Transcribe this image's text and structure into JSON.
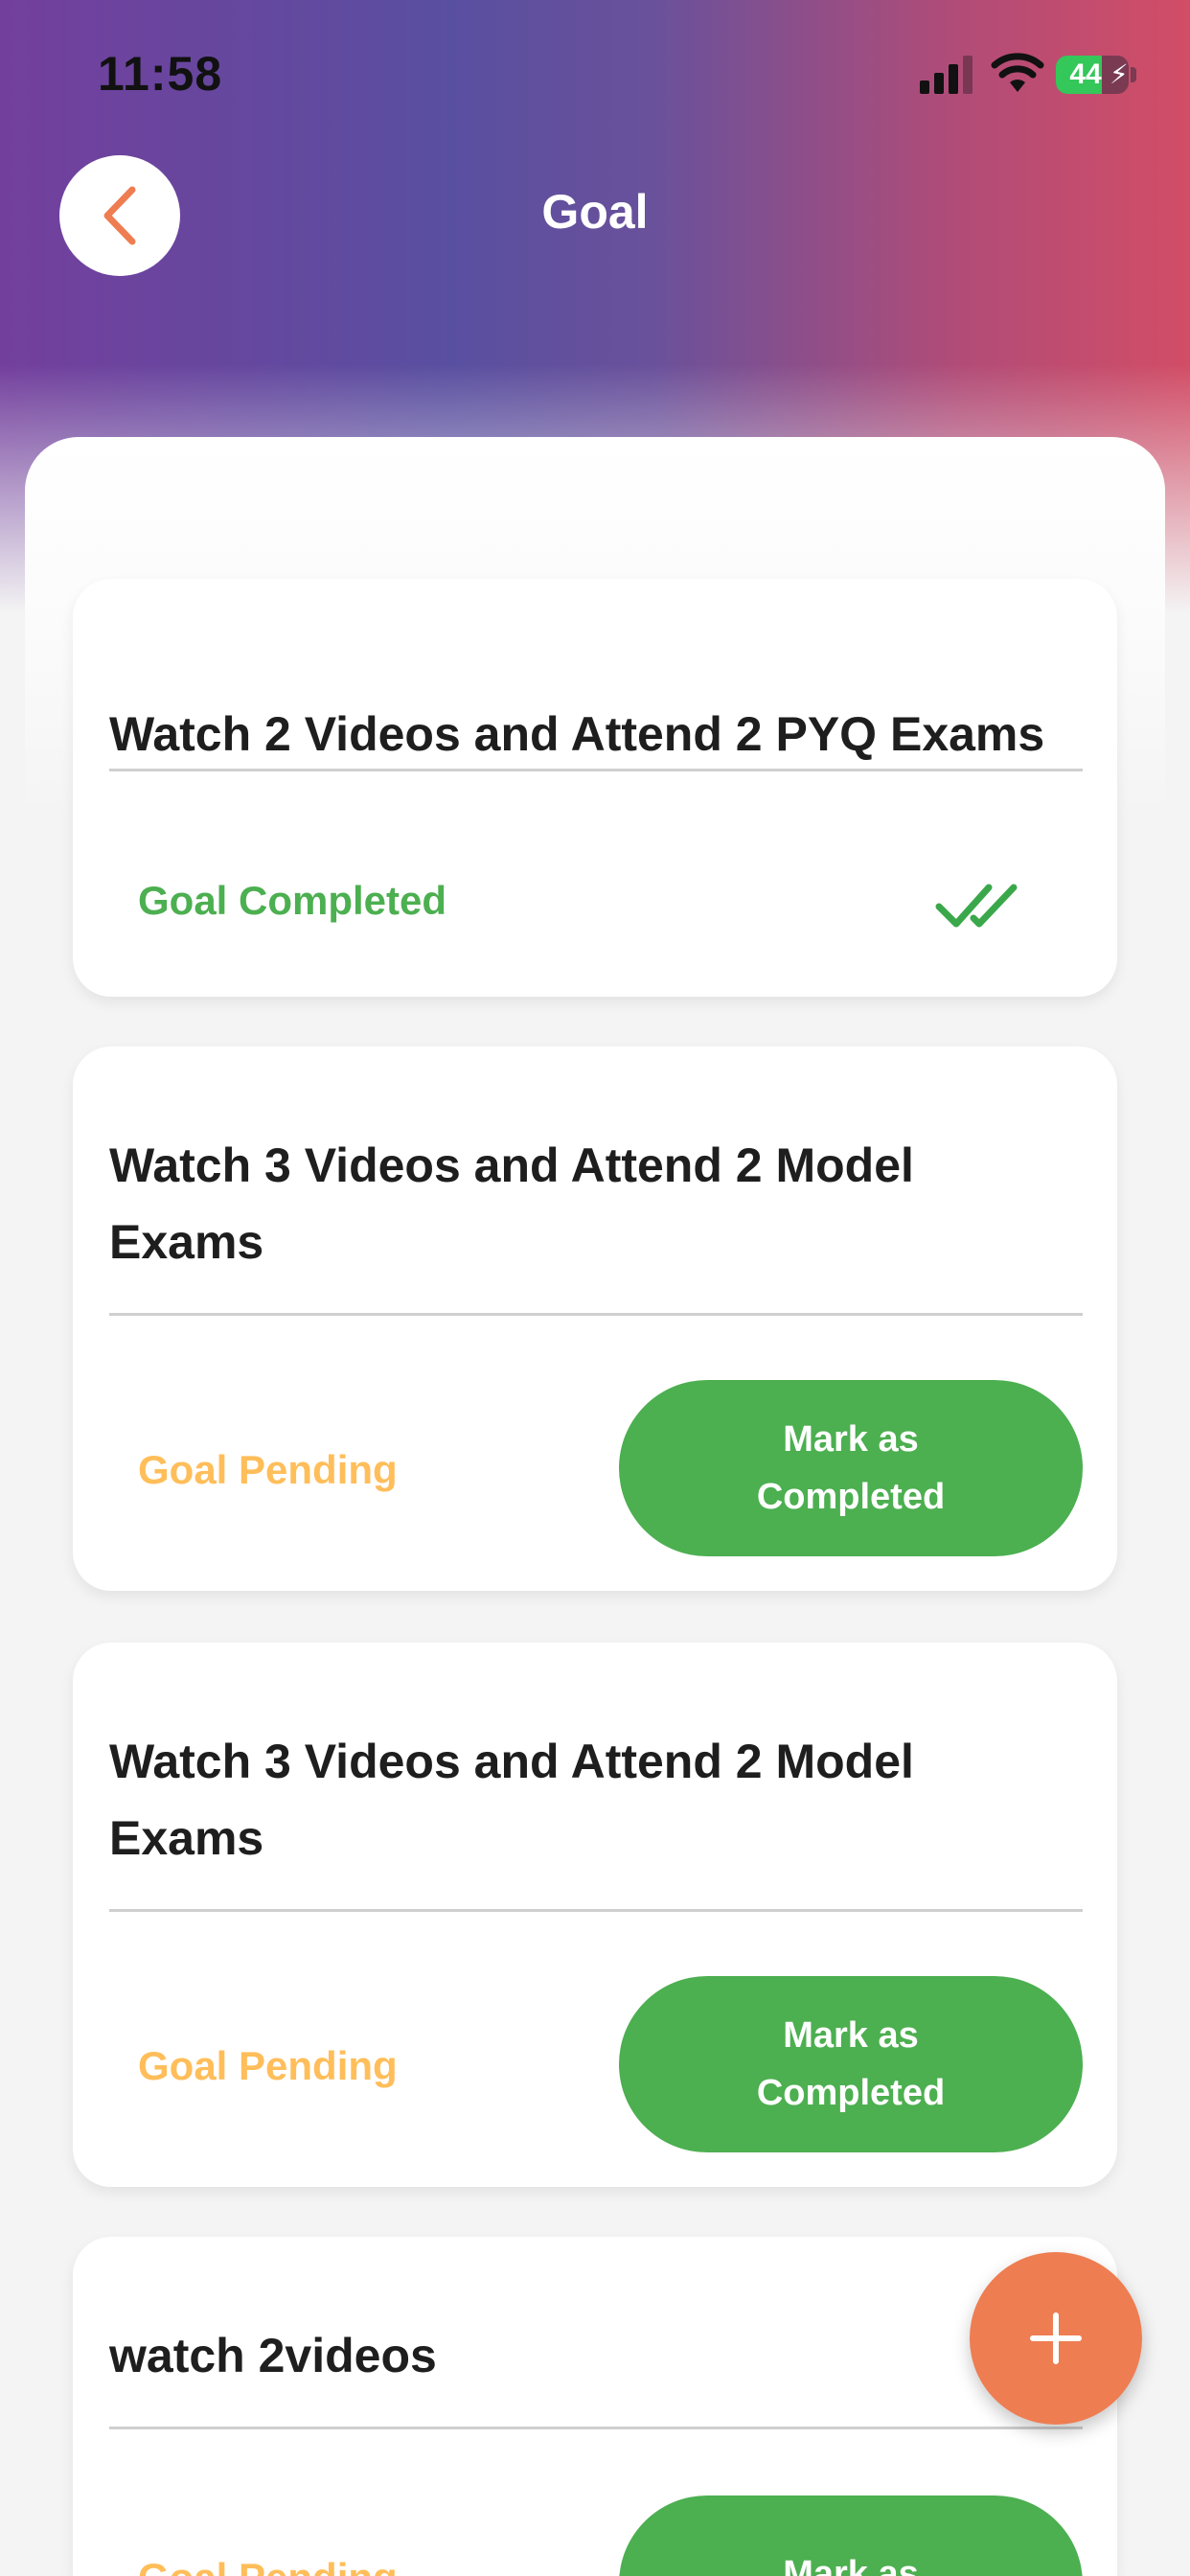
{
  "status_bar": {
    "time": "11:58",
    "battery_level": "44",
    "icons": [
      "signal-icon",
      "wifi-icon",
      "battery-charging-icon"
    ]
  },
  "header": {
    "title": "Goal",
    "back_icon": "chevron-left-icon"
  },
  "colors": {
    "completed": "#4caf50",
    "pending": "#ffbe5a",
    "button": "#4caf50",
    "fab": "#ef7d52",
    "back_icon": "#ef7d52"
  },
  "goals": [
    {
      "title": "Watch 2 Videos and Attend 2 PYQ Exams",
      "status": "Goal Completed",
      "completed": true,
      "status_icon": "double-check-icon"
    },
    {
      "title": "Watch 3 Videos and Attend 2 Model Exams",
      "status": "Goal Pending",
      "completed": false,
      "action_label": "Mark as Completed"
    },
    {
      "title": "Watch 3 Videos and Attend 2 Model Exams",
      "status": "Goal Pending",
      "completed": false,
      "action_label": "Mark as Completed"
    },
    {
      "title": "watch 2videos",
      "status": "Goal Pending",
      "completed": false,
      "action_label": "Mark as Completed"
    }
  ],
  "fab": {
    "icon": "plus-icon"
  }
}
